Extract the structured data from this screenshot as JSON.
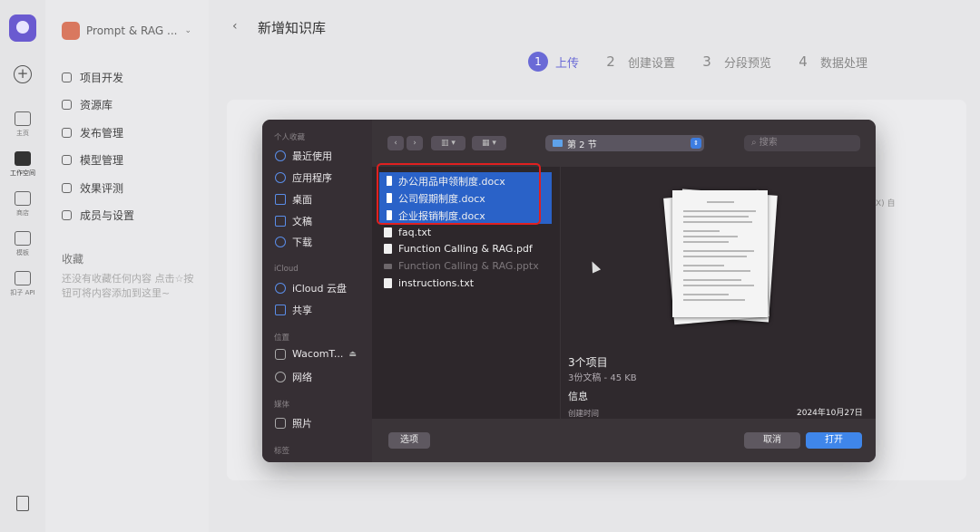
{
  "app": {
    "workspace_name": "Prompt & RAG ...",
    "rail": [
      {
        "label": "主页",
        "icon": "home-icon"
      },
      {
        "label": "工作空间",
        "icon": "terminal-icon",
        "active": true
      },
      {
        "label": "商店",
        "icon": "store-icon"
      },
      {
        "label": "模板",
        "icon": "template-icon"
      },
      {
        "label": "扣子 API",
        "icon": "api-icon"
      }
    ],
    "nav_items": [
      {
        "label": "项目开发",
        "icon": "project-icon"
      },
      {
        "label": "资源库",
        "icon": "library-icon"
      },
      {
        "label": "发布管理",
        "icon": "publish-icon"
      },
      {
        "label": "模型管理",
        "icon": "model-icon"
      },
      {
        "label": "效果评测",
        "icon": "evaluate-icon"
      },
      {
        "label": "成员与设置",
        "icon": "members-icon"
      }
    ],
    "favorites": {
      "title": "收藏",
      "empty_text": "还没有收藏任何内容 点击☆按钮可将内容添加到这里~"
    }
  },
  "page": {
    "back": "‹",
    "title": "新增知识库",
    "steps": [
      {
        "num": "1",
        "label": "上传",
        "active": true
      },
      {
        "num": "2",
        "label": "创建设置"
      },
      {
        "num": "3",
        "label": "分段预览"
      },
      {
        "num": "4",
        "label": "数据处理"
      }
    ],
    "bg_hint": "X) 自"
  },
  "dialog": {
    "sidebar": {
      "sections": [
        {
          "title": "个人收藏",
          "items": [
            {
              "label": "最近使用",
              "icon": "clock-icon"
            },
            {
              "label": "应用程序",
              "icon": "apps-icon"
            },
            {
              "label": "桌面",
              "icon": "desktop-icon"
            },
            {
              "label": "文稿",
              "icon": "document-icon"
            },
            {
              "label": "下载",
              "icon": "download-icon"
            }
          ]
        },
        {
          "title": "iCloud",
          "items": [
            {
              "label": "iCloud 云盘",
              "icon": "cloud-icon"
            },
            {
              "label": "共享",
              "icon": "shared-folder-icon"
            }
          ]
        },
        {
          "title": "位置",
          "items": [
            {
              "label": "WacomT...",
              "icon": "disk-icon"
            },
            {
              "label": "网络",
              "icon": "network-icon"
            }
          ]
        },
        {
          "title": "媒体",
          "items": [
            {
              "label": "照片",
              "icon": "photos-icon"
            }
          ]
        },
        {
          "title": "标签",
          "items": []
        }
      ]
    },
    "toolbar": {
      "back": "‹",
      "forward": "›",
      "view_columns": "▥ ▾",
      "view_grid": "▦ ▾",
      "location": "第 2 节",
      "search_placeholder": "搜索"
    },
    "files": [
      {
        "name": "办公用品申领制度.docx",
        "selected": true
      },
      {
        "name": "公司假期制度.docx",
        "selected": true
      },
      {
        "name": "企业报销制度.docx",
        "selected": true
      },
      {
        "name": "faq.txt"
      },
      {
        "name": "Function Calling & RAG.pdf"
      },
      {
        "name": "Function Calling & RAG.pptx",
        "disabled": true
      },
      {
        "name": "instructions.txt"
      }
    ],
    "preview": {
      "count": "3个项目",
      "summary": "3份文稿 - 45 KB",
      "info_title": "信息",
      "created_label": "创建时间",
      "created_value": "2024年10月27日"
    },
    "footer": {
      "options": "选项",
      "cancel": "取消",
      "open": "打开"
    }
  },
  "colors": {
    "accent": "#6a6ad6",
    "selection": "#2a62c8",
    "open_button": "#3f86ea",
    "highlight_box": "#e02020"
  }
}
